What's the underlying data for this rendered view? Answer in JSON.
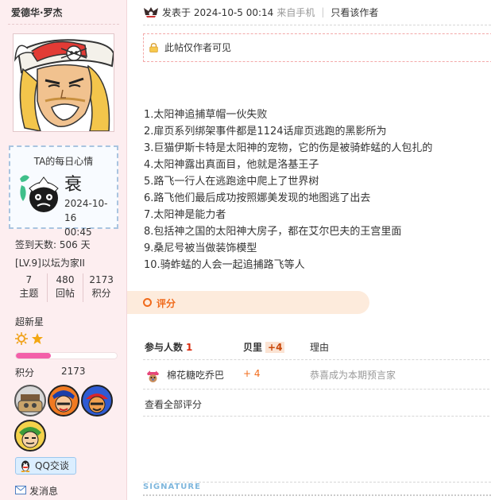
{
  "sidebar": {
    "username": "爱德华·罗杰",
    "mood": {
      "title": "TA的每日心情",
      "word": "衰",
      "date": "2024-10-16",
      "time": "00:45"
    },
    "sign_days": "签到天数: 506 天",
    "level": "[LV.9]以坛为家II",
    "stats": [
      {
        "value": "7",
        "label": "主题"
      },
      {
        "value": "480",
        "label": "回帖"
      },
      {
        "value": "2173",
        "label": "积分"
      }
    ],
    "rank": "超新星",
    "rank_progress": 0.35,
    "points_label": "积分",
    "points_value": "2173",
    "qq_button": "QQ交谈",
    "message_link": "发消息"
  },
  "post": {
    "posted_at": "发表于 2024-10-5 00:14",
    "source": "来自手机",
    "author_only": "只看该作者",
    "notice": "此帖仅作者可见",
    "lines": [
      "1.太阳神追捕草帽一伙失败",
      "2.扉页系列绑架事件都是1124话扉页逃跑的黑影所为",
      "3.巨猫伊斯卡特是太阳神的宠物，它的伤是被骑蚱蜢的人包扎的",
      "4.太阳神露出真面目，他就是洛基王子",
      "5.路飞一行人在逃跑途中爬上了世界树",
      "6.路飞他们最后成功按照娜美发现的地图逃了出去",
      "7.太阳神是能力者",
      "8.包括神之国的太阳神大房子，都在艾尔巴夫的王宫里面",
      "9.桑尼号被当做装饰模型",
      "10.骑蚱蜢的人会一起追捕路飞等人"
    ]
  },
  "rating": {
    "section_label": "评分",
    "header": {
      "participants": "参与人数",
      "participants_count": "1",
      "shells": "贝里",
      "shells_total": "+4",
      "reason": "理由"
    },
    "rows": [
      {
        "user": "棉花糖吃乔巴",
        "value": "+ 4",
        "reason": "恭喜成为本期预言家"
      }
    ],
    "view_all": "查看全部评分"
  },
  "signature": {
    "label": "SIGNATURE"
  },
  "colors": {
    "sidebar_bg": "#fdeef0",
    "accent_orange": "#f06a1b",
    "progress_pink": "#f35fa9",
    "signature_blue": "#7fb7dd"
  }
}
